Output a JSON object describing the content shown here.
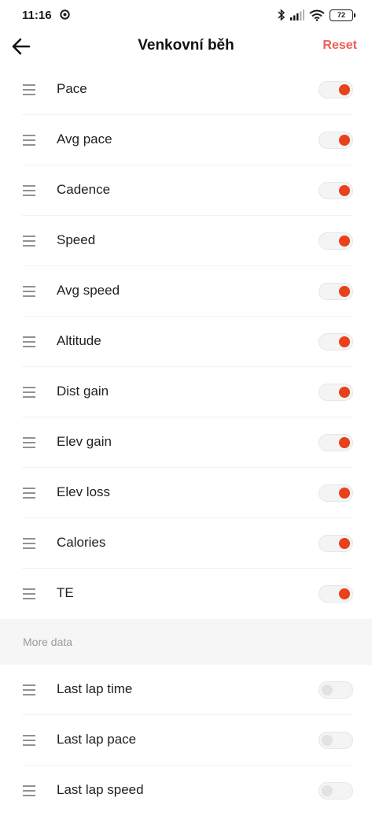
{
  "status_bar": {
    "time": "11:16",
    "battery": "72"
  },
  "header": {
    "title": "Venkovní běh",
    "reset_label": "Reset"
  },
  "active_items": [
    {
      "label": "Pace",
      "enabled": true
    },
    {
      "label": "Avg pace",
      "enabled": true
    },
    {
      "label": "Cadence",
      "enabled": true
    },
    {
      "label": "Speed",
      "enabled": true
    },
    {
      "label": "Avg speed",
      "enabled": true
    },
    {
      "label": "Altitude",
      "enabled": true
    },
    {
      "label": "Dist gain",
      "enabled": true
    },
    {
      "label": "Elev gain",
      "enabled": true
    },
    {
      "label": "Elev loss",
      "enabled": true
    },
    {
      "label": "Calories",
      "enabled": true
    },
    {
      "label": "TE",
      "enabled": true
    }
  ],
  "more_section": {
    "title": "More data",
    "items": [
      {
        "label": "Last lap time",
        "enabled": false
      },
      {
        "label": "Last lap pace",
        "enabled": false
      },
      {
        "label": "Last lap speed",
        "enabled": false
      }
    ]
  },
  "colors": {
    "accent": "#e8411c",
    "reset": "#ef5f55"
  }
}
